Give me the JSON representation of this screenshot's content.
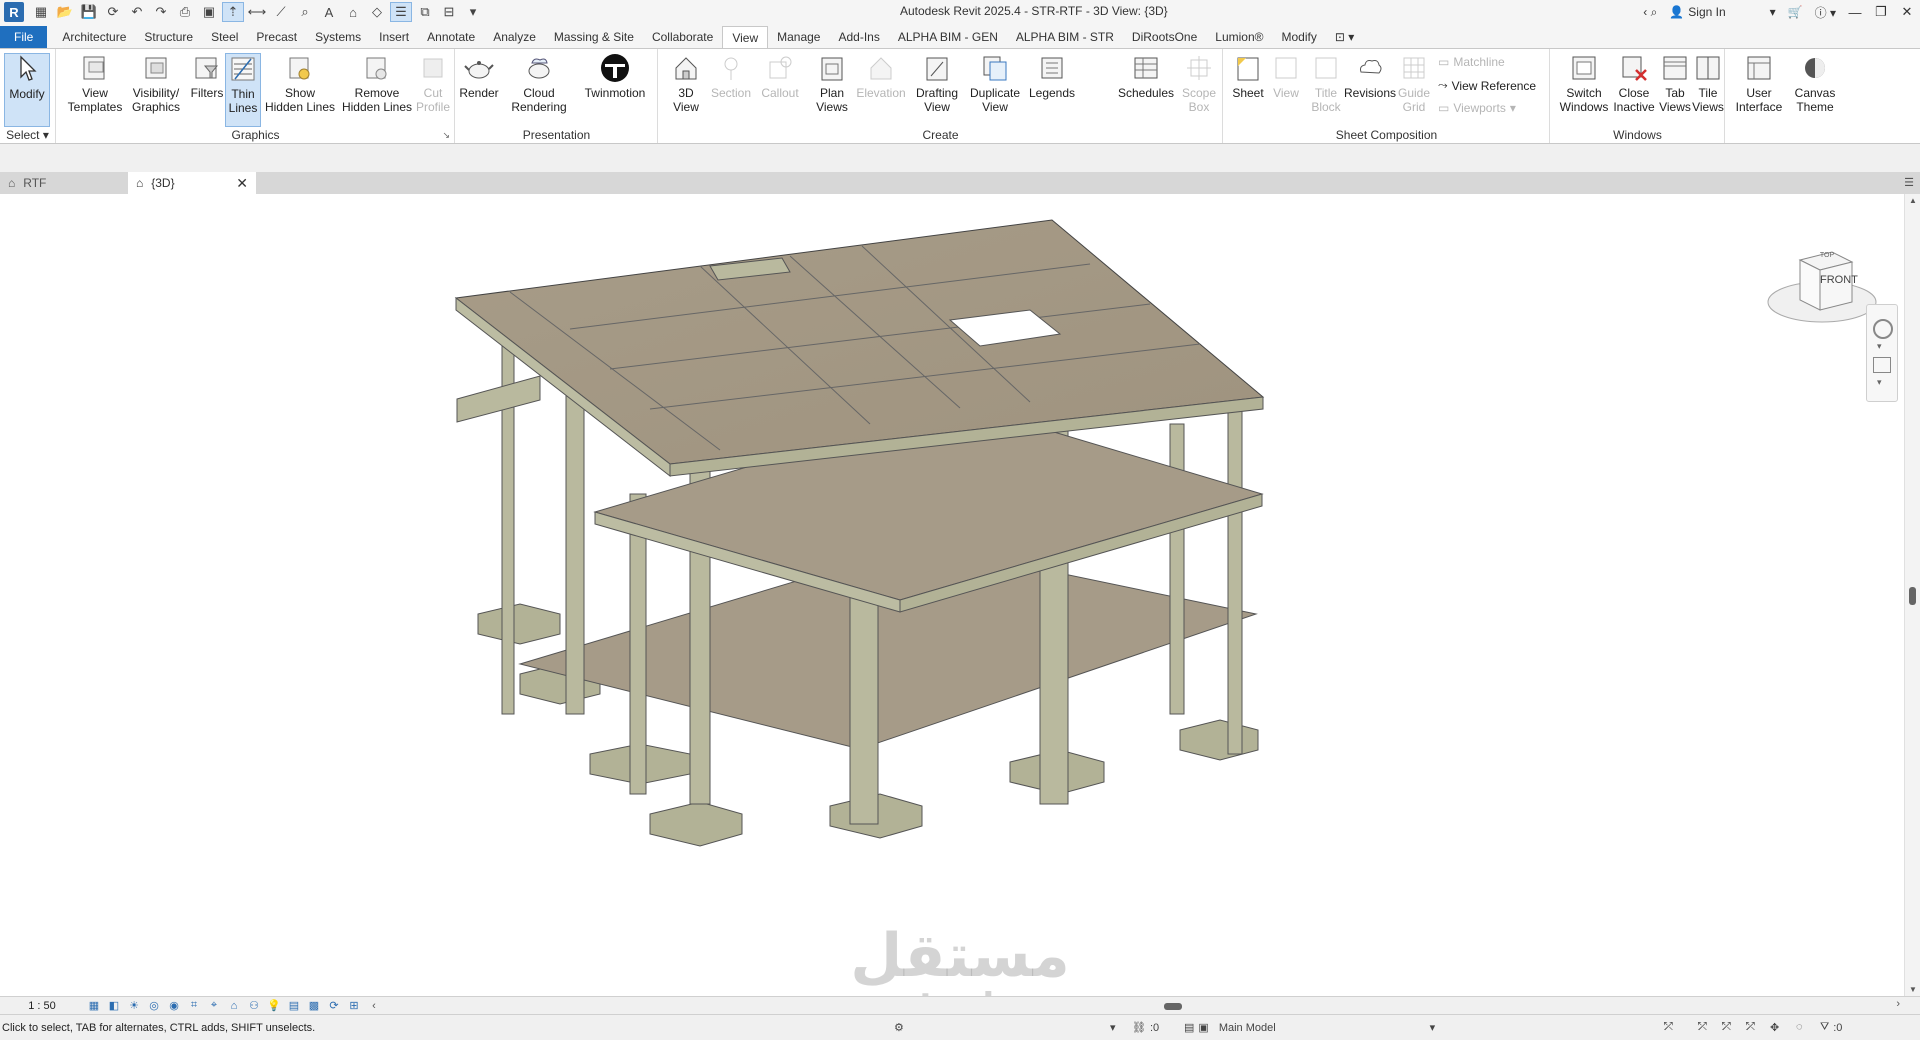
{
  "window": {
    "title": "Autodesk Revit 2025.4 - STR-RTF - 3D View: {3D}",
    "app_logo": "R",
    "sign_in": "Sign In"
  },
  "ribbon_tabs": [
    "File",
    "Architecture",
    "Structure",
    "Steel",
    "Precast",
    "Systems",
    "Insert",
    "Annotate",
    "Analyze",
    "Massing & Site",
    "Collaborate",
    "View",
    "Manage",
    "Add-Ins",
    "ALPHA BIM - GEN",
    "ALPHA BIM - STR",
    "DiRootsOne",
    "Lumion®",
    "Modify"
  ],
  "active_tab": "View",
  "ribbon": {
    "select": {
      "modify": "Modify",
      "panel": "Select"
    },
    "graphics": {
      "panel": "Graphics",
      "view_templates": [
        "View",
        "Templates"
      ],
      "visibility": [
        "Visibility/",
        "Graphics"
      ],
      "filters": "Filters",
      "thin_lines": [
        "Thin",
        "Lines"
      ],
      "show_hidden": [
        "Show",
        "Hidden Lines"
      ],
      "remove_hidden": [
        "Remove",
        "Hidden Lines"
      ],
      "cut_profile": [
        "Cut",
        "Profile"
      ]
    },
    "presentation": {
      "panel": "Presentation",
      "render": "Render",
      "cloud_rendering": [
        "Cloud",
        "Rendering"
      ],
      "twinmotion": "Twinmotion"
    },
    "create": {
      "panel": "Create",
      "view_3d": [
        "3D",
        "View"
      ],
      "section": "Section",
      "callout": "Callout",
      "plan_views": [
        "Plan",
        "Views"
      ],
      "elevation": "Elevation",
      "drafting_view": [
        "Drafting",
        "View"
      ],
      "duplicate_view": [
        "Duplicate",
        "View"
      ],
      "legends": "Legends",
      "schedules": "Schedules",
      "scope_box": [
        "Scope",
        "Box"
      ]
    },
    "sheet_composition": {
      "panel": "Sheet Composition",
      "sheet": "Sheet",
      "view": "View",
      "title_block": [
        "Title",
        "Block"
      ],
      "revisions": "Revisions",
      "guide_grid": [
        "Guide",
        "Grid"
      ],
      "matchline": "Matchline",
      "view_reference": "View  Reference",
      "viewports": "Viewports"
    },
    "windows": {
      "panel": "Windows",
      "switch_windows": [
        "Switch",
        "Windows"
      ],
      "close_inactive": [
        "Close",
        "Inactive"
      ],
      "tab_views": [
        "Tab",
        "Views"
      ],
      "tile_views": [
        "Tile",
        "Views"
      ]
    },
    "user_interface": [
      "User",
      "Interface"
    ],
    "canvas_theme": [
      "Canvas",
      "Theme"
    ]
  },
  "view_tabs": [
    {
      "label": "RTF",
      "active": false
    },
    {
      "label": "{3D}",
      "active": true
    }
  ],
  "viewcube": {
    "face": "FRONT",
    "top": "TOP"
  },
  "view_bar": {
    "scale": "1 : 50"
  },
  "status": {
    "hint": "Click to select, TAB for alternates, CTRL adds, SHIFT unselects.",
    "worksets": ":0",
    "model": "Main Model",
    "filter_count": ":0"
  },
  "watermark": {
    "arabic": "مستقل",
    "latin": "mostaql.com"
  },
  "colors": {
    "file_tab": "#1f6fbf",
    "concrete_top": "#a59a86",
    "concrete_side": "#b7b79c",
    "selected": "#cfe3f7"
  }
}
